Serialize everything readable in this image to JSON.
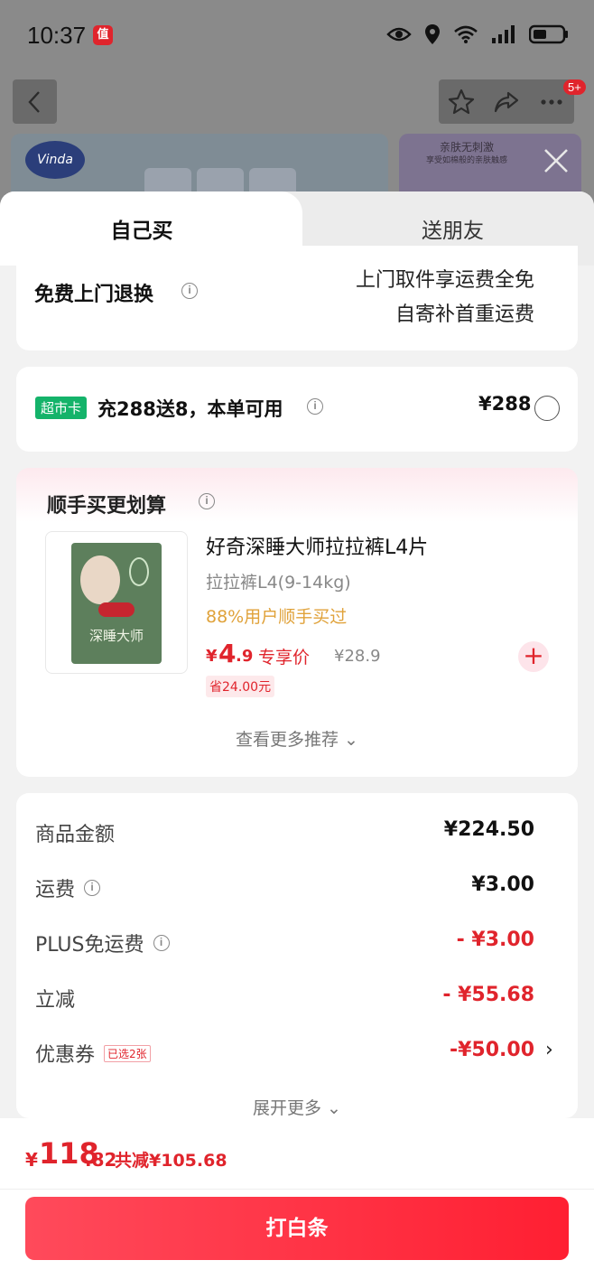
{
  "status_bar": {
    "time": "10:37",
    "app_icon_glyph": "值"
  },
  "header": {
    "cart_badge": "5+"
  },
  "banner": {
    "brand_logo": "Vinda",
    "right_title": "亲肤无刺激",
    "right_subtitle": "享受如棉般的亲肤触感"
  },
  "tabs": [
    {
      "label": "自己买",
      "active": true
    },
    {
      "label": "送朋友",
      "active": false
    }
  ],
  "return_service": {
    "title": "免费上门退换",
    "info_glyph": "i",
    "line1": "上门取件享运费全免",
    "line2": "自寄补首重运费"
  },
  "supermarket_card": {
    "tag": "超市卡",
    "text": "充288送8，本单可用",
    "info_glyph": "i",
    "price": "¥288",
    "selected": false
  },
  "recommend": {
    "title": "顺手买更划算",
    "info_glyph": "i",
    "product": {
      "pack_text": "深睡大师",
      "name": "好奇深睡大师拉拉裤L4片",
      "spec": "拉拉裤L4(9-14kg)",
      "bought_note": "88%用户顺手买过",
      "price_symbol": "¥",
      "price_int": "4",
      "price_dec": ".9",
      "price_tag": "专享价",
      "original_price": "¥28.9",
      "save": "省24.00元",
      "add_glyph": "+"
    },
    "more_label": "查看更多推荐 ⌄"
  },
  "summary": {
    "rows": [
      {
        "label": "商品金额",
        "value": "¥224.50",
        "info": false
      },
      {
        "label": "运费",
        "value": "¥3.00",
        "info": true
      },
      {
        "label": "PLUS免运费",
        "value": "- ¥3.00",
        "info": true
      },
      {
        "label": "立减",
        "value": "- ¥55.68",
        "info": false
      },
      {
        "label": "优惠券",
        "value": "-¥50.00",
        "tag": "已选2张",
        "chevron": "›"
      }
    ],
    "info_glyph": "i",
    "more_label": "展开更多 ⌄"
  },
  "footer": {
    "total_symbol": "¥",
    "total_int": "118",
    "total_dec": ".82",
    "total_saved": "共减¥105.68",
    "pay_button_label": "打白条"
  },
  "colors": {
    "accent": "#e0242c",
    "green_tag": "#14b36a",
    "orange_note": "#e0a23a"
  }
}
